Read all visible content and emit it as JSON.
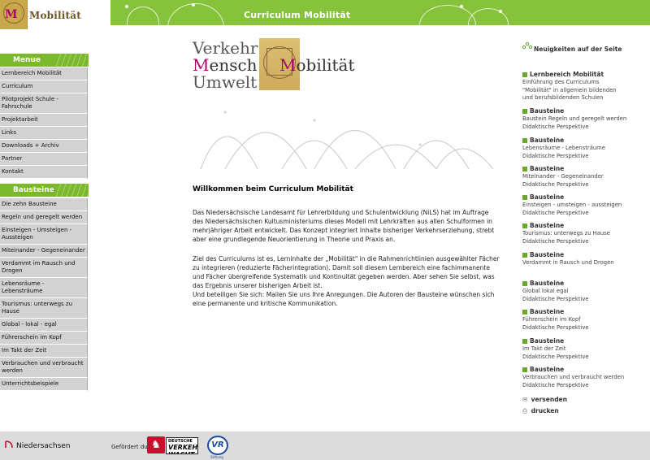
{
  "header": {
    "brand": "Mobilität",
    "logo_letter": "M",
    "title": "Curriculum Mobilität"
  },
  "menu": {
    "heading": "Menue",
    "items": [
      {
        "label": "Lernbereich Mobilität"
      },
      {
        "label": "Curriculum"
      },
      {
        "label": "Pilotprojekt Schule - Fahrschule"
      },
      {
        "label": "Projektarbeit"
      },
      {
        "label": "Links"
      },
      {
        "label": "Downloads + Archiv"
      },
      {
        "label": "Partner"
      },
      {
        "label": "Kontakt"
      }
    ]
  },
  "bausteine_menu": {
    "heading": "Bausteine",
    "items": [
      {
        "label": "Die zehn Bausteine"
      },
      {
        "label": "Regeln und geregelt werden"
      },
      {
        "label": "Einsteigen - Umsteigen - Aussteigen"
      },
      {
        "label": "Miteinander - Gegeneinander"
      },
      {
        "label": "Verdammt im Rausch und Drogen"
      },
      {
        "label": "Lebensräume - Lebensträume"
      },
      {
        "label": "Tourismus: unterwegs zu Hause"
      },
      {
        "label": "Global - lokal - egal"
      },
      {
        "label": "Führerschein im Kopf"
      },
      {
        "label": "Im Takt der Zeit"
      },
      {
        "label": "Verbrauchen und verbraucht werden"
      },
      {
        "label": "Unterrichtsbeispiele"
      }
    ]
  },
  "main_logo": {
    "word1": "Verkehr",
    "word2_initial": "M",
    "word2_rest": "ensch",
    "word3": "Umwelt",
    "word4_initial": "M",
    "word4_rest": "obilität"
  },
  "content": {
    "welcome": "Willkommen beim Curriculum Mobilität",
    "para1": "Das Niedersächsische Landesamt für Lehrerbildung und Schulentwicklung (NiLS) hat im Auftrage des Niedersächsischen Kultusministeriums dieses Modell mit Lehrkräften aus allen Schulformen in mehrjähriger Arbeit entwickelt. Das Konzept integriert Inhalte bisheriger Verkehrserziehung, strebt aber eine grundlegende Neuorientierung in Theorie und Praxis an.",
    "para2a": "Ziel des Curriculums ist es, Lerninhalte der „Mobilität\" in die Rahmenrichtlinien ausgewählter Fächer zu integrieren (reduzierte Fächerintegration). Damit soll diesem Lernbereich eine fachimmanente und Fächer übergreifende Systematik und Kontinuität gegeben werden. Aber sehen Sie selbst, was das Ergebnis unserer bisherigen Arbeit ist.",
    "para2b": "Und beteiligen Sie sich: Mailen Sie uns Ihre Anregungen. Die Autoren der Bausteine wünschen sich eine permanente und kritische Kommunikation."
  },
  "news": {
    "heading": "Neuigkeiten auf der Seite",
    "items": [
      {
        "title": "Lernbereich Mobilität",
        "lines": [
          "Einführung des Curriculums",
          "\"Mobilität\" in allgemein bildenden",
          "und berufsbildenden Schulen"
        ]
      },
      {
        "title": "Bausteine",
        "lines": [
          "Baustein Regeln und geregelt werden",
          "Didaktische Perspektive"
        ]
      },
      {
        "title": "Bausteine",
        "lines": [
          "Lebensräume - Lebensträume",
          "Didaktische Perspektive"
        ]
      },
      {
        "title": "Bausteine",
        "lines": [
          "Miteinander - Gegeneinander",
          "Didaktische Perspektive"
        ]
      },
      {
        "title": "Bausteine",
        "lines": [
          "Einsteigen - umsteigen - aussteigen",
          "Didaktische Perspektive"
        ]
      },
      {
        "title": "Bausteine",
        "lines": [
          "Tourismus: unterwegs zu Hause",
          "Didaktische Perspektive"
        ]
      },
      {
        "title": "Bausteine",
        "lines": [
          "Verdammt in Rausch und Drogen"
        ]
      },
      {
        "title": "Bausteine",
        "lines": [
          "Global lokal egal",
          "Didaktische Perspektive"
        ]
      },
      {
        "title": "Bausteine",
        "lines": [
          "Führerschein im Kopf",
          "Didaktische Perspektive"
        ]
      },
      {
        "title": "Bausteine",
        "lines": [
          "Im Takt der Zeit",
          "Didaktische Perspektive"
        ]
      },
      {
        "title": "Bausteine",
        "lines": [
          "Verbrauchen und verbraucht werden",
          "Didaktische Perspektive"
        ]
      }
    ],
    "send_label": "versenden",
    "print_label": "drucken"
  },
  "footer": {
    "state": "Niedersachsen",
    "sponsored_by": "Gefördert durch:",
    "vw_small": "DEUTSCHE",
    "vw_big": "VERKEHRS WACHT",
    "vr_label": "VR",
    "vr_sub": "Stiftung"
  },
  "colors": {
    "accent_green": "#86c33a",
    "menu_green": "#7cb82e",
    "menu_grey": "#d2d2d2",
    "logo_magenta": "#b0006a"
  }
}
